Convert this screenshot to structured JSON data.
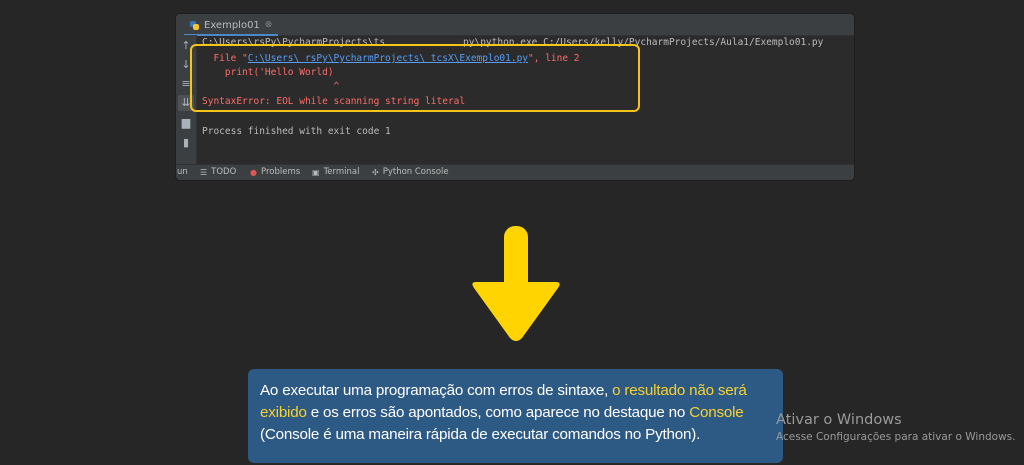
{
  "editor": {
    "tab": {
      "label": "Exemplo01",
      "close": "⊗"
    },
    "sidebar_icons": [
      "up-arrow-icon",
      "down-arrow-icon",
      "soft-wrap-icon",
      "scroll-to-end-icon",
      "print-icon",
      "trash-icon"
    ],
    "console": {
      "command_line": {
        "part1": "C:\\Users\\",
        "part2": "rsPy\\PycharmProjects\\ts",
        "part3": "py\\python.exe C:/Users/kelly/PycharmProjects/Aula1/Exemplo01.py"
      },
      "file_line": {
        "prefix": "  File \"",
        "path": "C:\\Users\\ rsPy\\PycharmProjects\\ tcsX\\Exemplo01.py",
        "suffix": "\", line 2"
      },
      "code_line": "    print('Hello World)",
      "caret_line": "                       ^",
      "error_line": "SyntaxError: EOL while scanning string literal",
      "exit_line": "Process finished with exit code 1"
    },
    "bottom_bar": {
      "run": "un",
      "todo": "TODO",
      "problems": "Problems",
      "terminal": "Terminal",
      "python_console": "Python Console"
    }
  },
  "info_box": {
    "text1": "Ao executar uma programação com erros de sintaxe, ",
    "highlight1": "o resultado não será exibido",
    "text2": " e os erros são apontados, como aparece no destaque no ",
    "highlight2": "Console",
    "text3": " (Console é uma maneira rápida de executar comandos no Python)."
  },
  "watermark": {
    "title": "Ativar o Windows",
    "subtitle": "Acesse Configurações para ativar o Windows."
  },
  "colors": {
    "highlight": "#f5c518",
    "error_text": "#ff6b68",
    "link": "#589df6",
    "info_bg": "#2d5985",
    "info_highlight": "#f7d22f",
    "arrow": "#ffd400"
  }
}
